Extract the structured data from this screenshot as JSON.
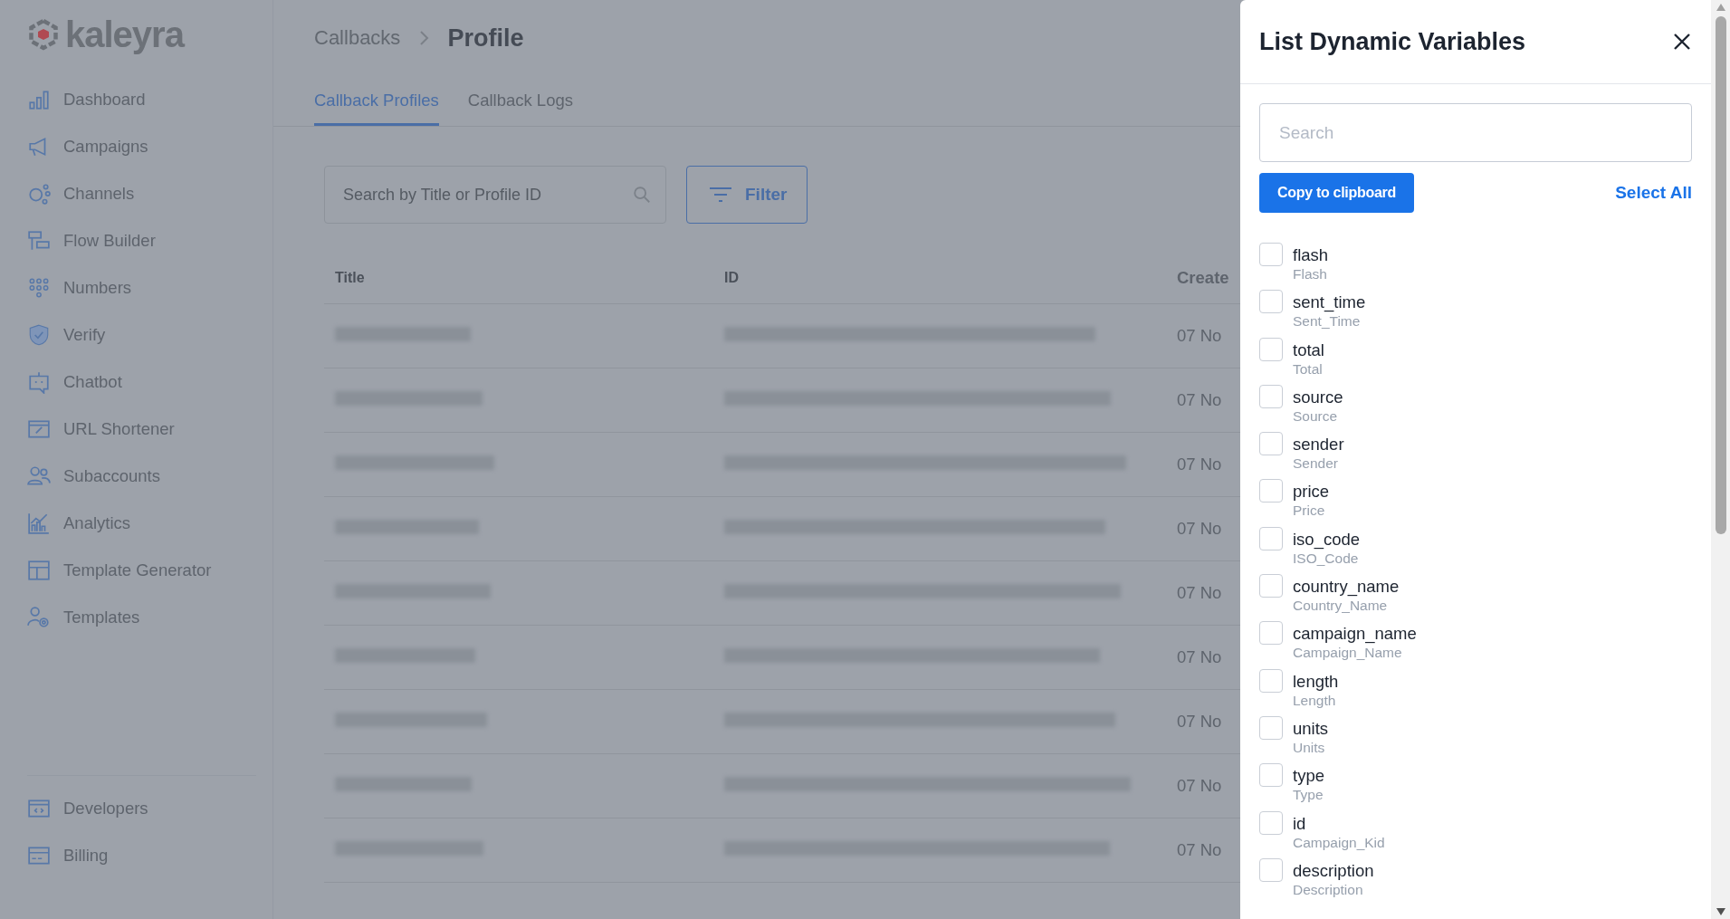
{
  "sidebar": {
    "logo": "kaleyra",
    "items": [
      {
        "label": "Dashboard"
      },
      {
        "label": "Campaigns"
      },
      {
        "label": "Channels"
      },
      {
        "label": "Flow Builder"
      },
      {
        "label": "Numbers"
      },
      {
        "label": "Verify"
      },
      {
        "label": "Chatbot"
      },
      {
        "label": "URL Shortener"
      },
      {
        "label": "Subaccounts"
      },
      {
        "label": "Analytics"
      },
      {
        "label": "Template Generator"
      },
      {
        "label": "Templates"
      }
    ],
    "footer_items": [
      {
        "label": "Developers"
      },
      {
        "label": "Billing"
      }
    ]
  },
  "breadcrumb": [
    "Callbacks",
    "Profile"
  ],
  "tabs": [
    {
      "label": "Callback Profiles",
      "selected": true
    },
    {
      "label": "Callback Logs",
      "selected": false
    }
  ],
  "search": {
    "placeholder": "Search by Title or Profile ID"
  },
  "filter_button": "Filter",
  "table": {
    "columns": [
      "Title",
      "ID",
      "Create"
    ],
    "rows": [
      {
        "created": "07 No"
      },
      {
        "created": "07 No"
      },
      {
        "created": "07 No"
      },
      {
        "created": "07 No"
      },
      {
        "created": "07 No"
      },
      {
        "created": "07 No"
      },
      {
        "created": "07 No"
      },
      {
        "created": "07 No"
      },
      {
        "created": "07 No"
      }
    ]
  },
  "panel": {
    "title": "List Dynamic Variables",
    "search_placeholder": "Search",
    "copy_button": "Copy to clipboard",
    "select_all": "Select All",
    "variables": [
      {
        "name": "flash",
        "label": "Flash",
        "checked": false
      },
      {
        "name": "sent_time",
        "label": "Sent_Time",
        "checked": false
      },
      {
        "name": "total",
        "label": "Total",
        "checked": false
      },
      {
        "name": "source",
        "label": "Source",
        "checked": false
      },
      {
        "name": "sender",
        "label": "Sender",
        "checked": false
      },
      {
        "name": "price",
        "label": "Price",
        "checked": false
      },
      {
        "name": "iso_code",
        "label": "ISO_Code",
        "checked": false
      },
      {
        "name": "country_name",
        "label": "Country_Name",
        "checked": false
      },
      {
        "name": "campaign_name",
        "label": "Campaign_Name",
        "checked": false
      },
      {
        "name": "length",
        "label": "Length",
        "checked": false
      },
      {
        "name": "units",
        "label": "Units",
        "checked": false
      },
      {
        "name": "type",
        "label": "Type",
        "checked": false
      },
      {
        "name": "id",
        "label": "Campaign_Kid",
        "checked": false
      },
      {
        "name": "description",
        "label": "Description",
        "checked": false
      }
    ]
  }
}
